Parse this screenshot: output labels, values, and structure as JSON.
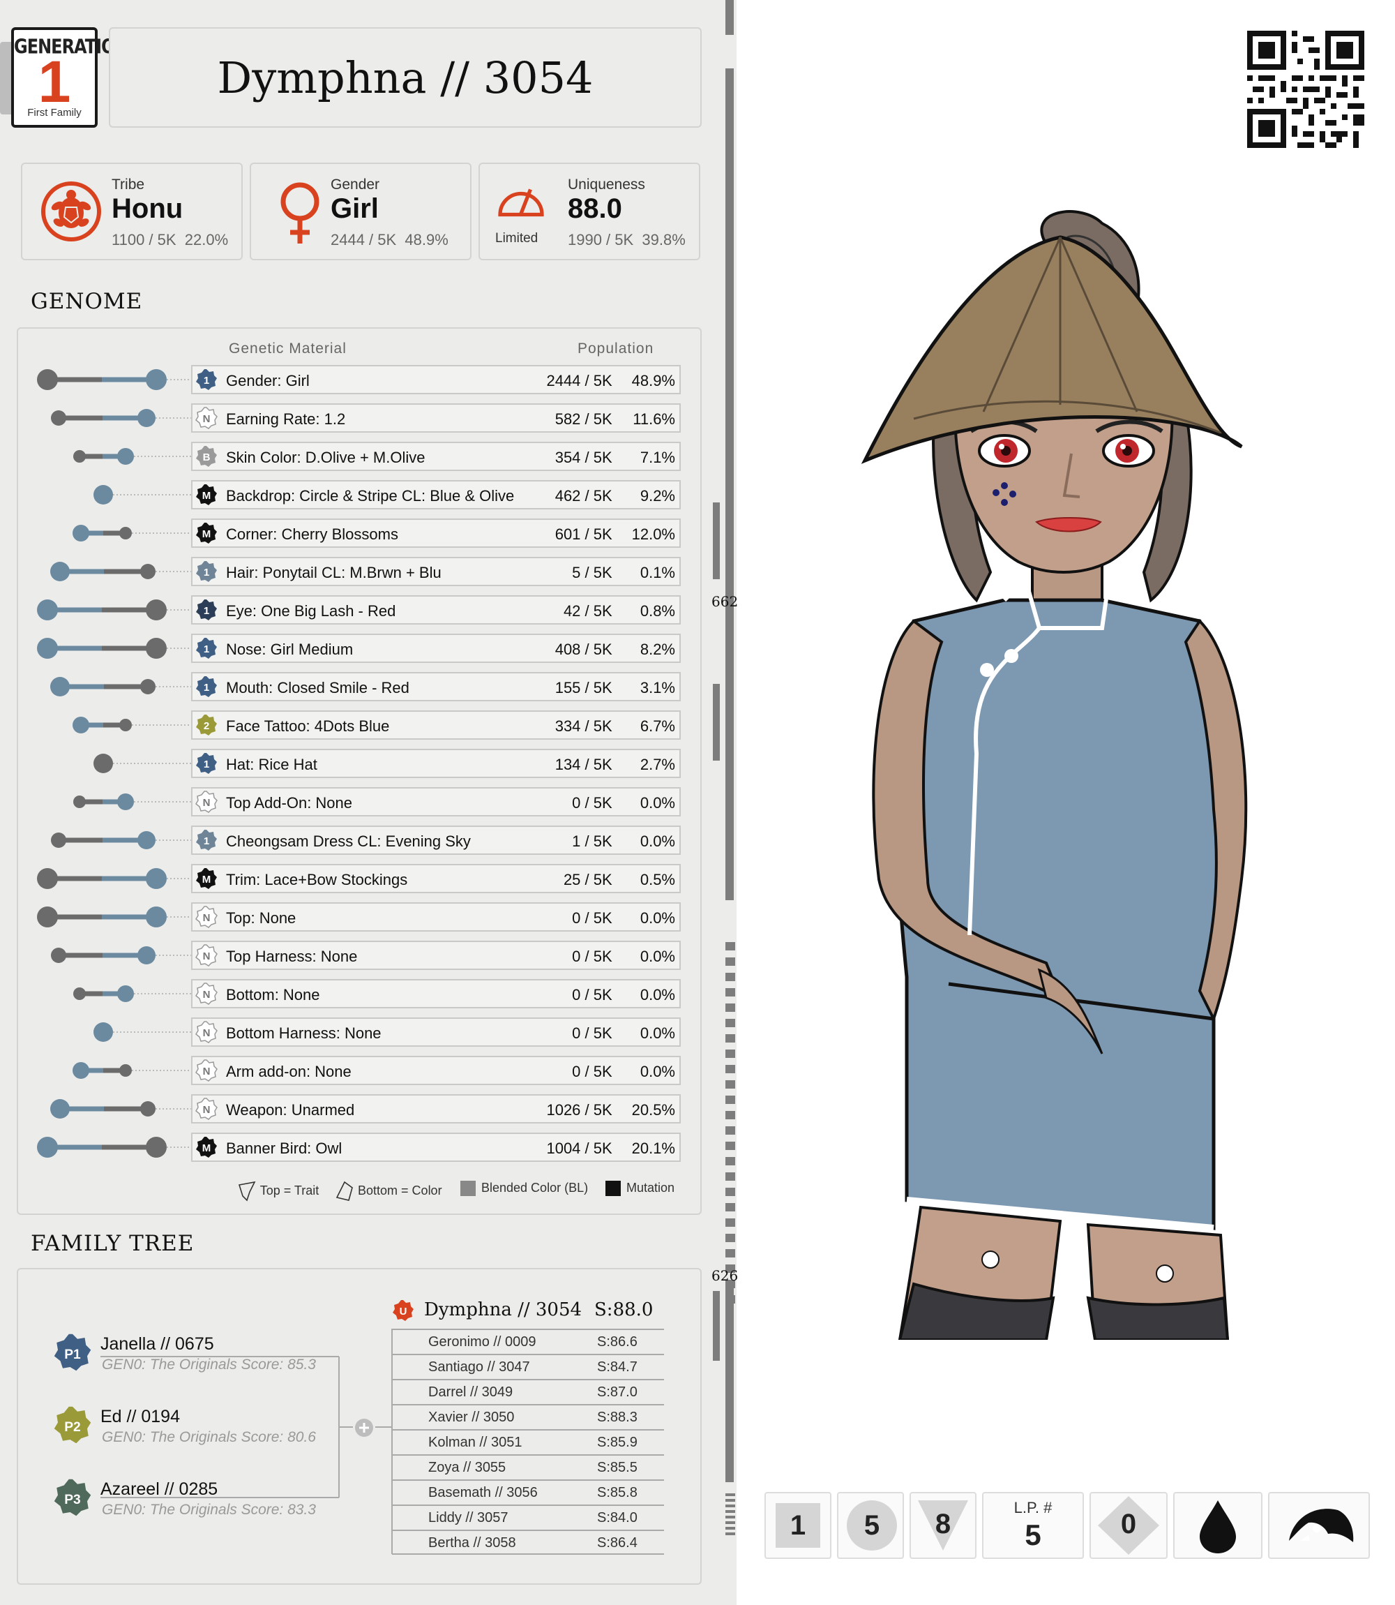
{
  "header": {
    "generation_label": "GENERATION",
    "generation_number": "1",
    "generation_sub": "First Family",
    "title": "Dymphna // 3054"
  },
  "stats": {
    "tribe": {
      "label": "Tribe",
      "value": "Honu",
      "count": "1100 / 5K",
      "pct": "22.0%"
    },
    "gender": {
      "label": "Gender",
      "value": "Girl",
      "count": "2444 / 5K",
      "pct": "48.9%"
    },
    "uniqueness": {
      "label": "Uniqueness",
      "value": "88.0",
      "badge": "Limited",
      "count": "1990 / 5K",
      "pct": "39.8%"
    }
  },
  "genome": {
    "title": "GENOME",
    "col_material": "Genetic Material",
    "col_population": "Population",
    "rows": [
      {
        "badge": "1",
        "badge_color": "#3f5f84",
        "name": "Gender: Girl",
        "count": "2444 / 5K",
        "pct": "48.9%"
      },
      {
        "badge": "N",
        "badge_color": "#ffffff",
        "name": "Earning Rate: 1.2",
        "count": "582 / 5K",
        "pct": "11.6%"
      },
      {
        "badge": "B",
        "badge_color": "#9a9a9a",
        "name": "Skin Color: D.Olive + M.Olive",
        "count": "354 / 5K",
        "pct": "7.1%"
      },
      {
        "badge": "M",
        "badge_color": "#111111",
        "name": "Backdrop: Circle & Stripe CL: Blue & Olive",
        "count": "462 / 5K",
        "pct": "9.2%"
      },
      {
        "badge": "M",
        "badge_color": "#111111",
        "name": "Corner: Cherry Blossoms",
        "count": "601 / 5K",
        "pct": "12.0%"
      },
      {
        "badge": "1",
        "badge_color": "#6f8497",
        "name": "Hair: Ponytail  CL: M.Brwn + Blu",
        "count": "5 / 5K",
        "pct": "0.1%"
      },
      {
        "badge": "1",
        "badge_color": "#2c3e57",
        "name": "Eye: One Big Lash - Red",
        "count": "42 / 5K",
        "pct": "0.8%"
      },
      {
        "badge": "1",
        "badge_color": "#3f5f84",
        "name": "Nose: Girl Medium",
        "count": "408 / 5K",
        "pct": "8.2%"
      },
      {
        "badge": "1",
        "badge_color": "#3f5f84",
        "name": "Mouth: Closed Smile - Red",
        "count": "155 / 5K",
        "pct": "3.1%"
      },
      {
        "badge": "2",
        "badge_color": "#9a9a38",
        "name": "Face Tattoo: 4Dots Blue",
        "count": "334 / 5K",
        "pct": "6.7%"
      },
      {
        "badge": "1",
        "badge_color": "#3f5f84",
        "name": "Hat: Rice Hat",
        "count": "134 / 5K",
        "pct": "2.7%"
      },
      {
        "badge": "N",
        "badge_color": "#ffffff",
        "name": "Top Add-On: None",
        "count": "0 / 5K",
        "pct": "0.0%"
      },
      {
        "badge": "1",
        "badge_color": "#6f8497",
        "name": "Cheongsam Dress CL: Evening Sky",
        "count": "1 / 5K",
        "pct": "0.0%"
      },
      {
        "badge": "M",
        "badge_color": "#111111",
        "name": "Trim: Lace+Bow Stockings",
        "count": "25 / 5K",
        "pct": "0.5%"
      },
      {
        "badge": "N",
        "badge_color": "#ffffff",
        "name": "Top: None",
        "count": "0 / 5K",
        "pct": "0.0%"
      },
      {
        "badge": "N",
        "badge_color": "#ffffff",
        "name": "Top Harness: None",
        "count": "0 / 5K",
        "pct": "0.0%"
      },
      {
        "badge": "N",
        "badge_color": "#ffffff",
        "name": "Bottom: None",
        "count": "0 / 5K",
        "pct": "0.0%"
      },
      {
        "badge": "N",
        "badge_color": "#ffffff",
        "name": "Bottom Harness: None",
        "count": "0 / 5K",
        "pct": "0.0%"
      },
      {
        "badge": "N",
        "badge_color": "#ffffff",
        "name": "Arm add-on: None",
        "count": "0 / 5K",
        "pct": "0.0%"
      },
      {
        "badge": "N",
        "badge_color": "#ffffff",
        "name": "Weapon: Unarmed",
        "count": "1026 / 5K",
        "pct": "20.5%"
      },
      {
        "badge": "M",
        "badge_color": "#111111",
        "name": "Banner Bird:  Owl",
        "count": "1004 / 5K",
        "pct": "20.1%"
      }
    ],
    "legend": {
      "top": "Top = Trait",
      "bottom": "Bottom = Color",
      "blended": "Blended Color (BL)",
      "mutation": "Mutation"
    }
  },
  "family_tree": {
    "title": "FAMILY TREE",
    "parents": [
      {
        "tag": "P1",
        "name": "Janella  //  0675",
        "score": "GEN0: The Originals Score: 85.3",
        "color": "#3f5f84"
      },
      {
        "tag": "P2",
        "name": "Ed  //  0194",
        "score": "GEN0: The Originals Score: 80.6",
        "color": "#9a9a38"
      },
      {
        "tag": "P3",
        "name": "Azareel  //  0285",
        "score": "GEN0: The Originals Score: 83.3",
        "color": "#4f6a5a"
      }
    ],
    "self": {
      "tag": "U",
      "name": "Dymphna // 3054",
      "score": "S:88.0"
    },
    "siblings": [
      {
        "name": "Geronimo  //  0009",
        "score": "S:86.6"
      },
      {
        "name": "Santiago  //  3047",
        "score": "S:84.7"
      },
      {
        "name": "Darrel  //  3049",
        "score": "S:87.0"
      },
      {
        "name": "Xavier  //  3050",
        "score": "S:88.3"
      },
      {
        "name": "Kolman  //  3051",
        "score": "S:85.9"
      },
      {
        "name": "Zoya  //  3055",
        "score": "S:85.5"
      },
      {
        "name": "Basemath  //  3056",
        "score": "S:85.8"
      },
      {
        "name": "Liddy  //  3057",
        "score": "S:84.0"
      },
      {
        "name": "Bertha  //  3058",
        "score": "S:86.4"
      }
    ]
  },
  "scale": {
    "upper": "662",
    "lower": "626"
  },
  "traits": {
    "t1": "1",
    "t2": "5",
    "t3": "8",
    "lp_label": "L.P. #",
    "lp_value": "5",
    "t4": "0"
  }
}
